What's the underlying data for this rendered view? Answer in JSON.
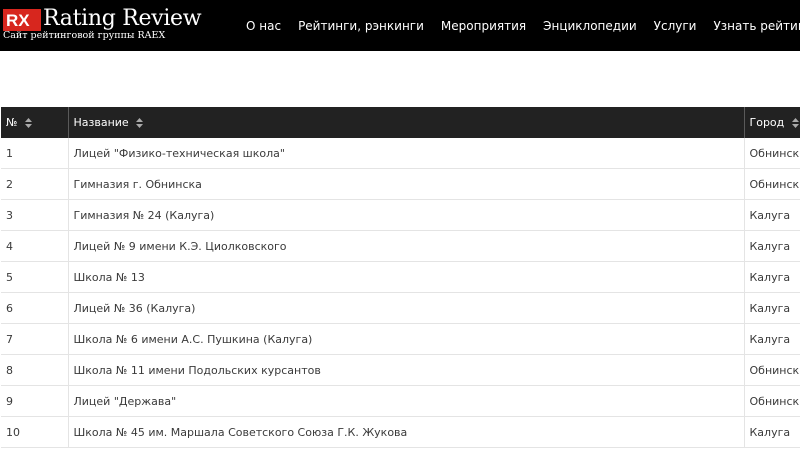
{
  "header": {
    "logo_mark": "RX",
    "logo_title": "Rating Review",
    "logo_subtitle": "Сайт рейтинговой группы RAEX",
    "nav": [
      "О нас",
      "Рейтинги, рэнкинги",
      "Мероприятия",
      "Энциклопедии",
      "Услуги",
      "Узнать рейтинг"
    ]
  },
  "table": {
    "columns": [
      "№",
      "Название",
      "Город"
    ],
    "rows": [
      {
        "num": "1",
        "name": "Лицей \"Физико-техническая школа\"",
        "city": "Обнинск"
      },
      {
        "num": "2",
        "name": "Гимназия г. Обнинска",
        "city": "Обнинск"
      },
      {
        "num": "3",
        "name": "Гимназия № 24 (Калуга)",
        "city": "Калуга"
      },
      {
        "num": "4",
        "name": "Лицей № 9 имени К.Э. Циолковского",
        "city": "Калуга"
      },
      {
        "num": "5",
        "name": "Школа № 13",
        "city": "Калуга"
      },
      {
        "num": "6",
        "name": "Лицей № 36 (Калуга)",
        "city": "Калуга"
      },
      {
        "num": "7",
        "name": "Школа № 6 имени А.С. Пушкина (Калуга)",
        "city": "Калуга"
      },
      {
        "num": "8",
        "name": "Школа № 11 имени Подольских курсантов",
        "city": "Обнинск"
      },
      {
        "num": "9",
        "name": "Лицей \"Держава\"",
        "city": "Обнинск"
      },
      {
        "num": "10",
        "name": "Школа № 45 им. Маршала Советского Союза Г.К. Жукова",
        "city": "Калуга"
      }
    ]
  },
  "colors": {
    "topbar": "#000000",
    "table_header": "#222222",
    "logo_red": "#d7261e"
  },
  "icons": {
    "sort": "sort-updown-icon"
  }
}
